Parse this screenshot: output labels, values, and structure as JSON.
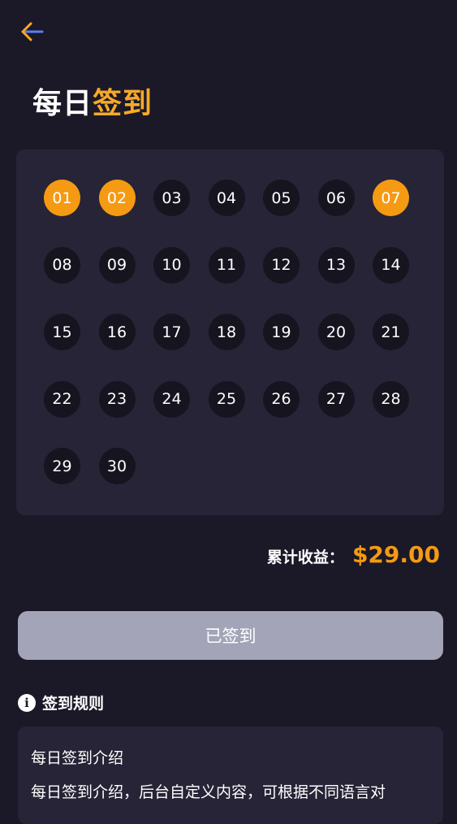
{
  "header": {
    "title_main": "每日",
    "title_accent": "签到",
    "back_icon": "arrow-left-icon"
  },
  "calendar": {
    "days": [
      {
        "label": "01",
        "signed": true
      },
      {
        "label": "02",
        "signed": true
      },
      {
        "label": "03",
        "signed": false
      },
      {
        "label": "04",
        "signed": false
      },
      {
        "label": "05",
        "signed": false
      },
      {
        "label": "06",
        "signed": false
      },
      {
        "label": "07",
        "signed": true
      },
      {
        "label": "08",
        "signed": false
      },
      {
        "label": "09",
        "signed": false
      },
      {
        "label": "10",
        "signed": false
      },
      {
        "label": "11",
        "signed": false
      },
      {
        "label": "12",
        "signed": false
      },
      {
        "label": "13",
        "signed": false
      },
      {
        "label": "14",
        "signed": false
      },
      {
        "label": "15",
        "signed": false
      },
      {
        "label": "16",
        "signed": false
      },
      {
        "label": "17",
        "signed": false
      },
      {
        "label": "18",
        "signed": false
      },
      {
        "label": "19",
        "signed": false
      },
      {
        "label": "20",
        "signed": false
      },
      {
        "label": "21",
        "signed": false
      },
      {
        "label": "22",
        "signed": false
      },
      {
        "label": "23",
        "signed": false
      },
      {
        "label": "24",
        "signed": false
      },
      {
        "label": "25",
        "signed": false
      },
      {
        "label": "26",
        "signed": false
      },
      {
        "label": "27",
        "signed": false
      },
      {
        "label": "28",
        "signed": false
      },
      {
        "label": "29",
        "signed": false
      },
      {
        "label": "30",
        "signed": false
      }
    ]
  },
  "earnings": {
    "label": "累计收益：",
    "value": "$29.00"
  },
  "sign_button": {
    "label": "已签到"
  },
  "rules": {
    "title": "签到规则",
    "icon": "info-icon",
    "line1": "每日签到介绍",
    "line2": "每日签到介绍，后台自定义内容，可根据不同语言对"
  },
  "colors": {
    "background": "#1b1928",
    "card": "#262436",
    "accent": "#f59a13",
    "day_unsigned": "#16141f",
    "button_disabled": "#a3a4b8"
  }
}
